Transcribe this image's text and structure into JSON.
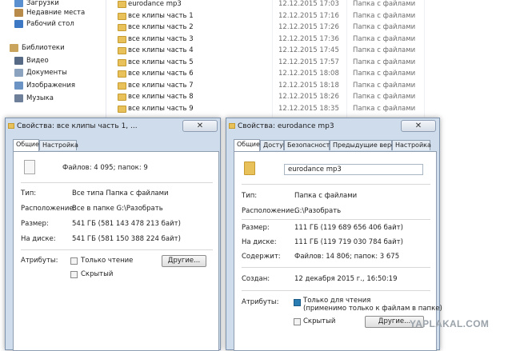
{
  "sidebar": {
    "items": [
      {
        "label": "Загрузки",
        "icon": "downloads-icon"
      },
      {
        "label": "Недавние места",
        "icon": "recent-places-icon"
      },
      {
        "label": "Рабочий стол",
        "icon": "desktop-icon"
      },
      {
        "label": "Библиотеки",
        "icon": "libraries-icon"
      },
      {
        "label": "Видео",
        "icon": "video-library-icon"
      },
      {
        "label": "Документы",
        "icon": "documents-library-icon"
      },
      {
        "label": "Изображения",
        "icon": "pictures-library-icon"
      },
      {
        "label": "Музыка",
        "icon": "music-library-icon"
      }
    ]
  },
  "files": [
    {
      "name": "eurodance mp3",
      "date": "12.12.2015 17:03",
      "type": "Папка с файлами"
    },
    {
      "name": "все клипы часть 1",
      "date": "12.12.2015 17:16",
      "type": "Папка с файлами"
    },
    {
      "name": "все клипы часть 2",
      "date": "12.12.2015 17:26",
      "type": "Папка с файлами"
    },
    {
      "name": "все клипы часть 3",
      "date": "12.12.2015 17:36",
      "type": "Папка с файлами"
    },
    {
      "name": "все клипы часть 4",
      "date": "12.12.2015 17:45",
      "type": "Папка с файлами"
    },
    {
      "name": "все клипы часть 5",
      "date": "12.12.2015 17:57",
      "type": "Папка с файлами"
    },
    {
      "name": "все клипы часть 6",
      "date": "12.12.2015 18:08",
      "type": "Папка с файлами"
    },
    {
      "name": "все клипы часть 7",
      "date": "12.12.2015 18:18",
      "type": "Папка с файлами"
    },
    {
      "name": "все клипы часть 8",
      "date": "12.12.2015 18:26",
      "type": "Папка с файлами"
    },
    {
      "name": "все клипы часть 9",
      "date": "12.12.2015 18:35",
      "type": "Папка с файлами"
    }
  ],
  "dialog1": {
    "title": "Свойства: все клипы часть 1, ...",
    "close": "✕",
    "tabs": [
      "Общие",
      "Настройка"
    ],
    "summary": "Файлов: 4 095; папок: 9",
    "type_label": "Тип:",
    "type_value": "Все типа Папка с файлами",
    "location_label": "Расположение:",
    "location_value": "Все в папке G:\\Разобрать",
    "size_label": "Размер:",
    "size_value": "541 ГБ (581 143 478 213 байт)",
    "disk_label": "На диске:",
    "disk_value": "541 ГБ (581 150 388 224 байт)",
    "attributes_label": "Атрибуты:",
    "readonly_label": "Только чтение",
    "hidden_label": "Скрытый",
    "other_button": "Другие..."
  },
  "dialog2": {
    "title": "Свойства: eurodance mp3",
    "close": "✕",
    "tabs": [
      "Общие",
      "Доступ",
      "Безопасность",
      "Предыдущие версии",
      "Настройка"
    ],
    "name_value": "eurodance mp3",
    "type_label": "Тип:",
    "type_value": "Папка с файлами",
    "location_label": "Расположение:",
    "location_value": "G:\\Разобрать",
    "size_label": "Размер:",
    "size_value": "111 ГБ (119 689 656 406 байт)",
    "disk_label": "На диске:",
    "disk_value": "111 ГБ (119 719 030 784 байт)",
    "contains_label": "Содержит:",
    "contains_value": "Файлов: 14 806; папок: 3 675",
    "created_label": "Создан:",
    "created_value": "12 декабря 2015 г., 16:50:19",
    "attributes_label": "Атрибуты:",
    "readonly_label": "Только для чтения",
    "readonly_note": "(применимо только к файлам в папке)",
    "hidden_label": "Скрытый",
    "other_button": "Другие..."
  },
  "watermark": "YAPLAKAL.COM"
}
